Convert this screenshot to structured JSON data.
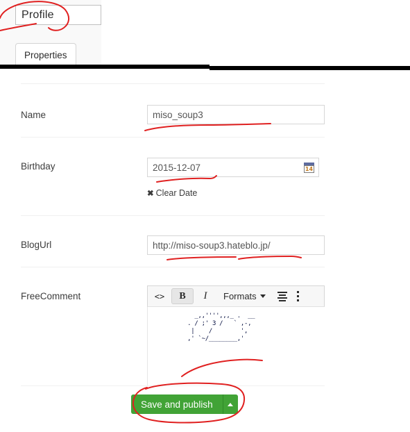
{
  "header": {
    "node_name": "Profile",
    "tabs": [
      {
        "label": "Properties",
        "active": true
      }
    ]
  },
  "form": {
    "fields": [
      {
        "label": "Name",
        "value": "miso_soup3",
        "placeholder": ""
      },
      {
        "label": "Birthday",
        "value": "2015-12-07",
        "placeholder": "",
        "calendar_icon": "calendar-icon",
        "calendar_day": "14",
        "clear_label": "Clear Date",
        "clear_icon": "✖"
      },
      {
        "label": "BlogUrl",
        "value": "http://miso-soup3.hateblo.jp/",
        "placeholder": ""
      },
      {
        "label": "FreeComment",
        "value": "   _,,'''',,,_ .  __\n . / ;' 3 /   ` ,-,\n  |    /        ',\n ,' `~/________,'"
      }
    ]
  },
  "editor": {
    "toolbar": [
      {
        "name": "source-code-icon",
        "label": "<>"
      },
      {
        "name": "bold-button",
        "label": "B",
        "active": true
      },
      {
        "name": "italic-button",
        "label": "I"
      },
      {
        "name": "formats-dropdown",
        "label": "Formats"
      },
      {
        "name": "align-left-icon",
        "label": ""
      },
      {
        "name": "more-toolbar-icon",
        "label": ""
      }
    ]
  },
  "footer": {
    "save_label": "Save and publish",
    "save_color": "#41a336"
  },
  "annotation": {
    "color": "#e02020",
    "note": "hand-drawn red ink marks"
  }
}
